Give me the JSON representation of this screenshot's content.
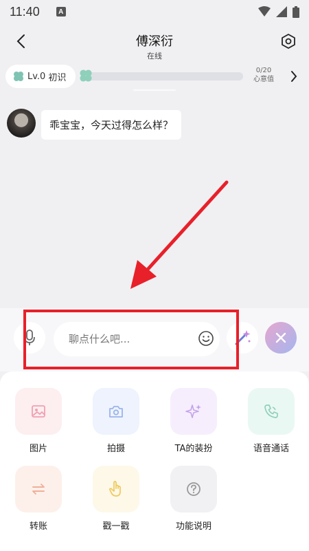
{
  "status": {
    "time": "11:40"
  },
  "header": {
    "title": "傅深衍",
    "subtitle": "在线"
  },
  "level": {
    "badge": "Lv.0",
    "stage": "初识",
    "progress_text": "0/20",
    "progress_label": "心意值",
    "progress_fraction": 0.0
  },
  "chat": {
    "messages": [
      {
        "text": "乖宝宝，今天过得怎么样？"
      }
    ]
  },
  "input": {
    "placeholder": "聊点什么吧..."
  },
  "functions": [
    {
      "label": "图片",
      "icon": "image-icon",
      "bg": "#fdeef0",
      "color": "#f0a0b0"
    },
    {
      "label": "拍摄",
      "icon": "camera-icon",
      "bg": "#eef3fd",
      "color": "#9bb4ec"
    },
    {
      "label": "TA的装扮",
      "icon": "sparkle-icon",
      "bg": "#f6eefd",
      "color": "#c4a4ea"
    },
    {
      "label": "语音通话",
      "icon": "phone-icon",
      "bg": "#eaf8f3",
      "color": "#8fd0bb"
    },
    {
      "label": "转账",
      "icon": "transfer-icon",
      "bg": "#fdf0ea",
      "color": "#f0b09a"
    },
    {
      "label": "戳一戳",
      "icon": "poke-icon",
      "bg": "#fdf8e8",
      "color": "#f0c85a"
    },
    {
      "label": "功能说明",
      "icon": "help-icon",
      "bg": "#f1f1f3",
      "color": "#999999"
    }
  ],
  "colors": {
    "annotation_red": "#e8202a",
    "accent_gradient_start": "#e6a6cf",
    "accent_gradient_end": "#a4b6ee"
  }
}
